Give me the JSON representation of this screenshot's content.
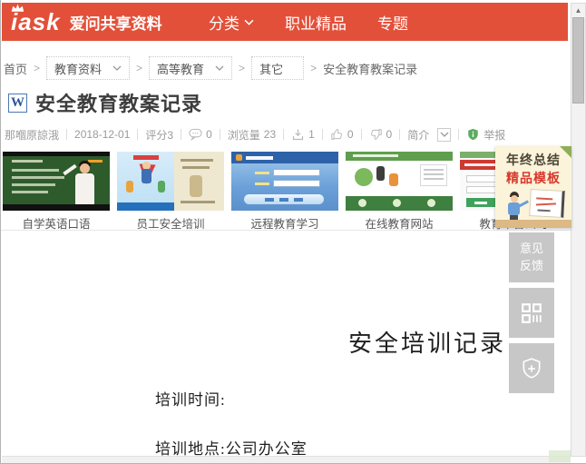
{
  "colors": {
    "brand_red": "#e2503a",
    "ad_red": "#d8382c",
    "shield_green": "#55a25a",
    "doc_icon_blue": "#2b579a"
  },
  "header": {
    "logo_text": "iask",
    "logo_suffix": "爱问共享资料",
    "nav": [
      {
        "label": "分类"
      },
      {
        "label": "职业精品"
      },
      {
        "label": "专题"
      }
    ]
  },
  "breadcrumb": {
    "home": "首页",
    "items": [
      {
        "label": "教育资料"
      },
      {
        "label": "高等教育"
      },
      {
        "label": "其它"
      }
    ],
    "current": "安全教育教案记录"
  },
  "doc": {
    "type_badge": "W",
    "title": "安全教育教案记录",
    "author": "那嗰原諒涐",
    "date": "2018-12-01",
    "rating": "评分3",
    "comments": "0",
    "views_label": "浏览量",
    "views": "23",
    "downloads": "1",
    "likes": "0",
    "dislikes": "0",
    "intro": "简介",
    "report": "举报"
  },
  "related": [
    {
      "label": "自学英语口语"
    },
    {
      "label": "员工安全培训"
    },
    {
      "label": "远程教育学习"
    },
    {
      "label": "在线教育网站"
    },
    {
      "label": "教育平台公司"
    }
  ],
  "preview": {
    "heading": "安全培训记录",
    "line1": "培训时间:",
    "line2": "培训地点:公司办公室"
  },
  "float_buttons": {
    "feedback_line1": "意见",
    "feedback_line2": "反馈"
  },
  "ad": {
    "line1": "年终总结",
    "line2": "精品模板"
  }
}
